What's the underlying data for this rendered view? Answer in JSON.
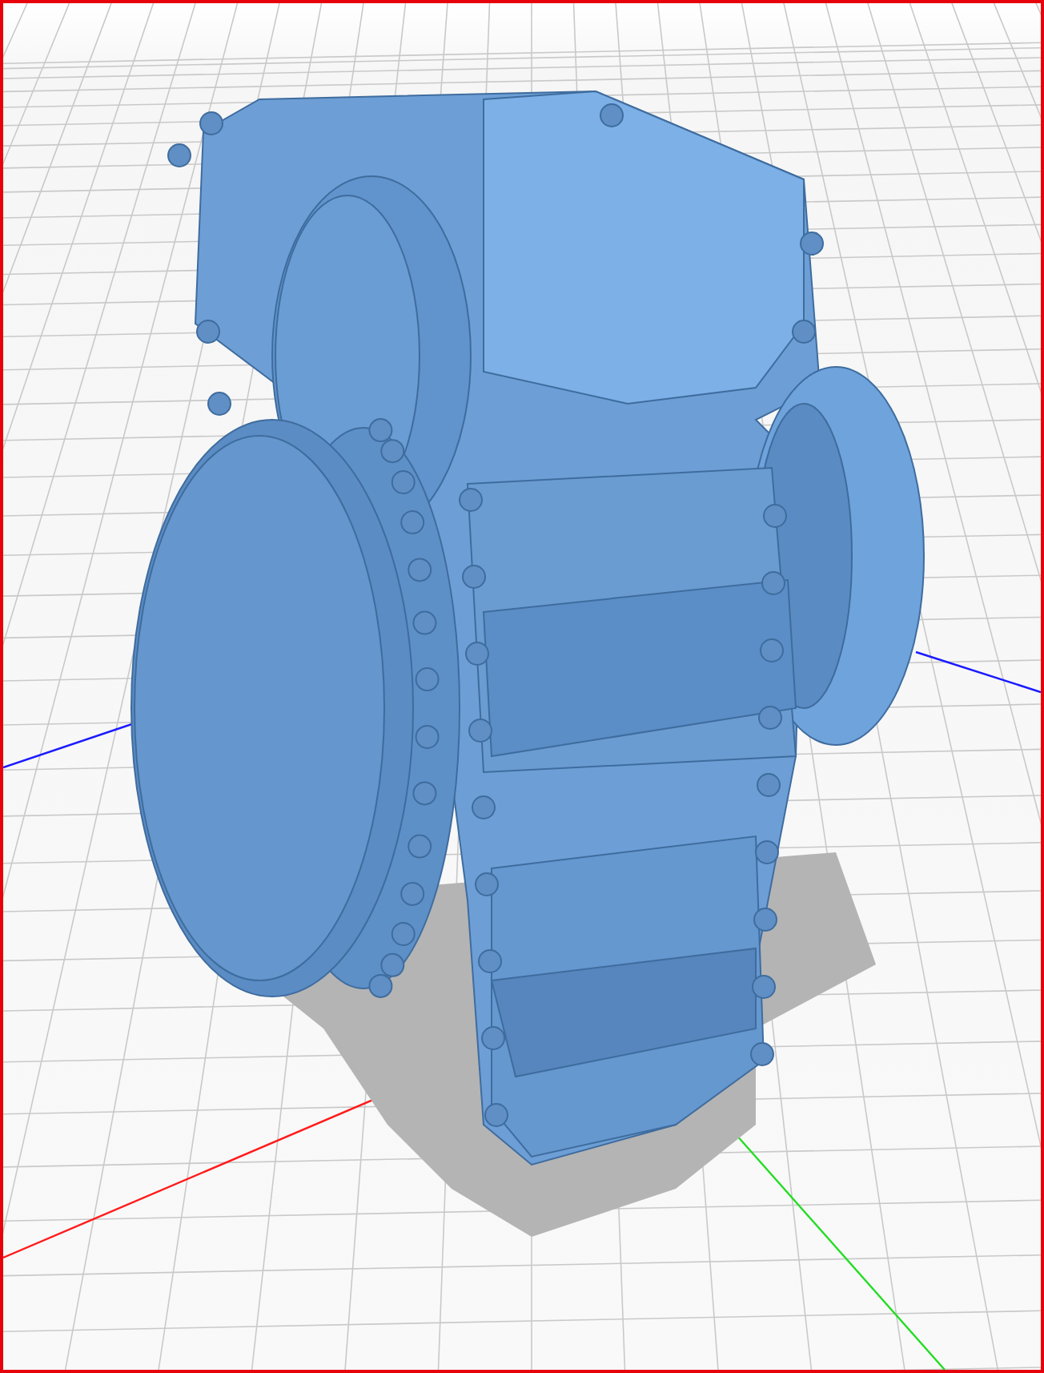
{
  "viewport": {
    "selected": true
  }
}
